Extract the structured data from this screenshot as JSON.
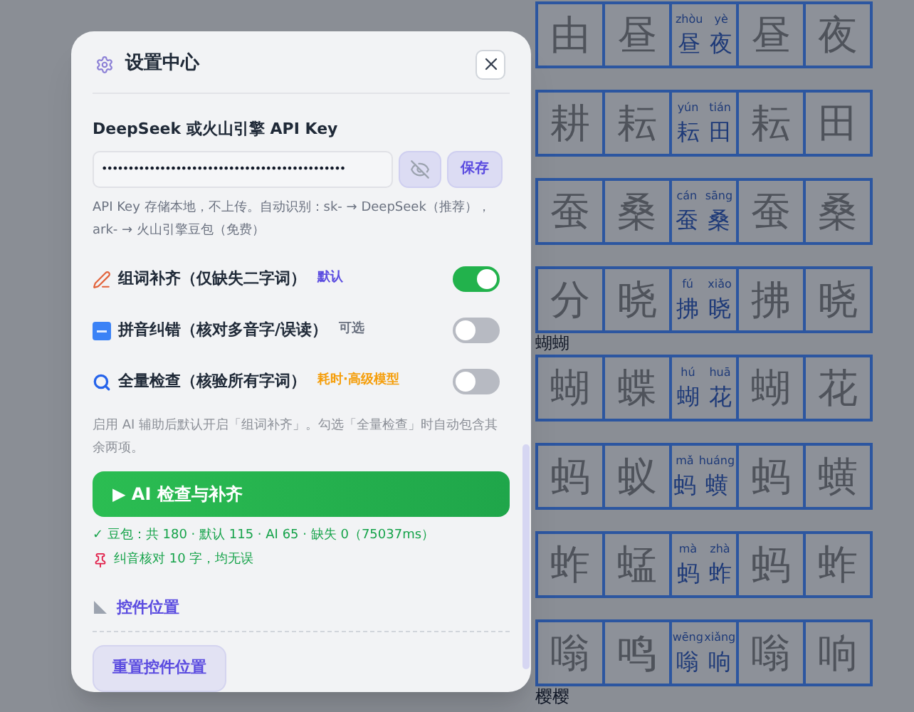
{
  "worksheet": [
    {
      "kind": "row",
      "trace": [
        "由",
        "昼",
        "昼",
        "夜"
      ],
      "pinyin": [
        "zhòu",
        "yè"
      ],
      "word": [
        "昼",
        "夜"
      ]
    },
    {
      "kind": "row",
      "trace": [
        "耕",
        "耘",
        "耘",
        "田"
      ],
      "pinyin": [
        "yún",
        "tián"
      ],
      "word": [
        "耘",
        "田"
      ]
    },
    {
      "kind": "row",
      "trace": [
        "蚕",
        "桑",
        "蚕",
        "桑"
      ],
      "pinyin": [
        "cán",
        "sāng"
      ],
      "word": [
        "蚕",
        "桑"
      ]
    },
    {
      "kind": "row",
      "trace": [
        "分",
        "晓",
        "拂",
        "晓"
      ],
      "pinyin": [
        "fú",
        "xiǎo"
      ],
      "word": [
        "拂",
        "晓"
      ]
    },
    {
      "kind": "heading",
      "text": "蝴蝴"
    },
    {
      "kind": "row",
      "trace": [
        "蝴",
        "蝶",
        "蝴",
        "花"
      ],
      "pinyin": [
        "hú",
        "huā"
      ],
      "word": [
        "蝴",
        "花"
      ]
    },
    {
      "kind": "row",
      "trace": [
        "蚂",
        "蚁",
        "蚂",
        "蟥"
      ],
      "pinyin": [
        "mǎ",
        "huáng"
      ],
      "word": [
        "蚂",
        "蟥"
      ]
    },
    {
      "kind": "row",
      "trace": [
        "蚱",
        "蜢",
        "蚂",
        "蚱"
      ],
      "pinyin": [
        "mà",
        "zhà"
      ],
      "word": [
        "蚂",
        "蚱"
      ]
    },
    {
      "kind": "row",
      "trace": [
        "嗡",
        "鸣",
        "嗡",
        "响"
      ],
      "pinyin": [
        "wēng",
        "xiǎng"
      ],
      "word": [
        "嗡",
        "响"
      ]
    },
    {
      "kind": "heading",
      "text": "樱樱"
    }
  ],
  "dialog": {
    "title": "设置中心",
    "api_key": {
      "label": "DeepSeek 或火山引擎 API Key",
      "value": "••••••••••••••••••••••••••••••••••••••••••••••",
      "save": "保存",
      "hint": "API Key 存储本地，不上传。自动识别：sk- → DeepSeek（推荐），ark- → 火山引擎豆包（免费）"
    },
    "options": [
      {
        "label": "组词补齐（仅缺失二字词）",
        "tag": "默认",
        "color": "#5b4ce0",
        "on": true
      },
      {
        "label": "拼音纠错（核对多音字/误读）",
        "tag": "可选",
        "color": "#6b7280",
        "on": false
      },
      {
        "label": "全量检查（核验所有字词）",
        "tag": "耗时·高级模型",
        "color": "#f59e0b",
        "on": false
      }
    ],
    "note": "启用 AI 辅助后默认开启「组词补齐」。勾选「全量检查」时自动包含其余两项。",
    "run_button": "▶ AI 检查与补齐",
    "status": "✓ 豆包：共 180 · 默认 115 · AI 65 · 缺失 0（75037ms）",
    "pinyin_result": "纠音核对 10 字，均无误",
    "section": "控件位置",
    "reset_button": "重置控件位置"
  }
}
